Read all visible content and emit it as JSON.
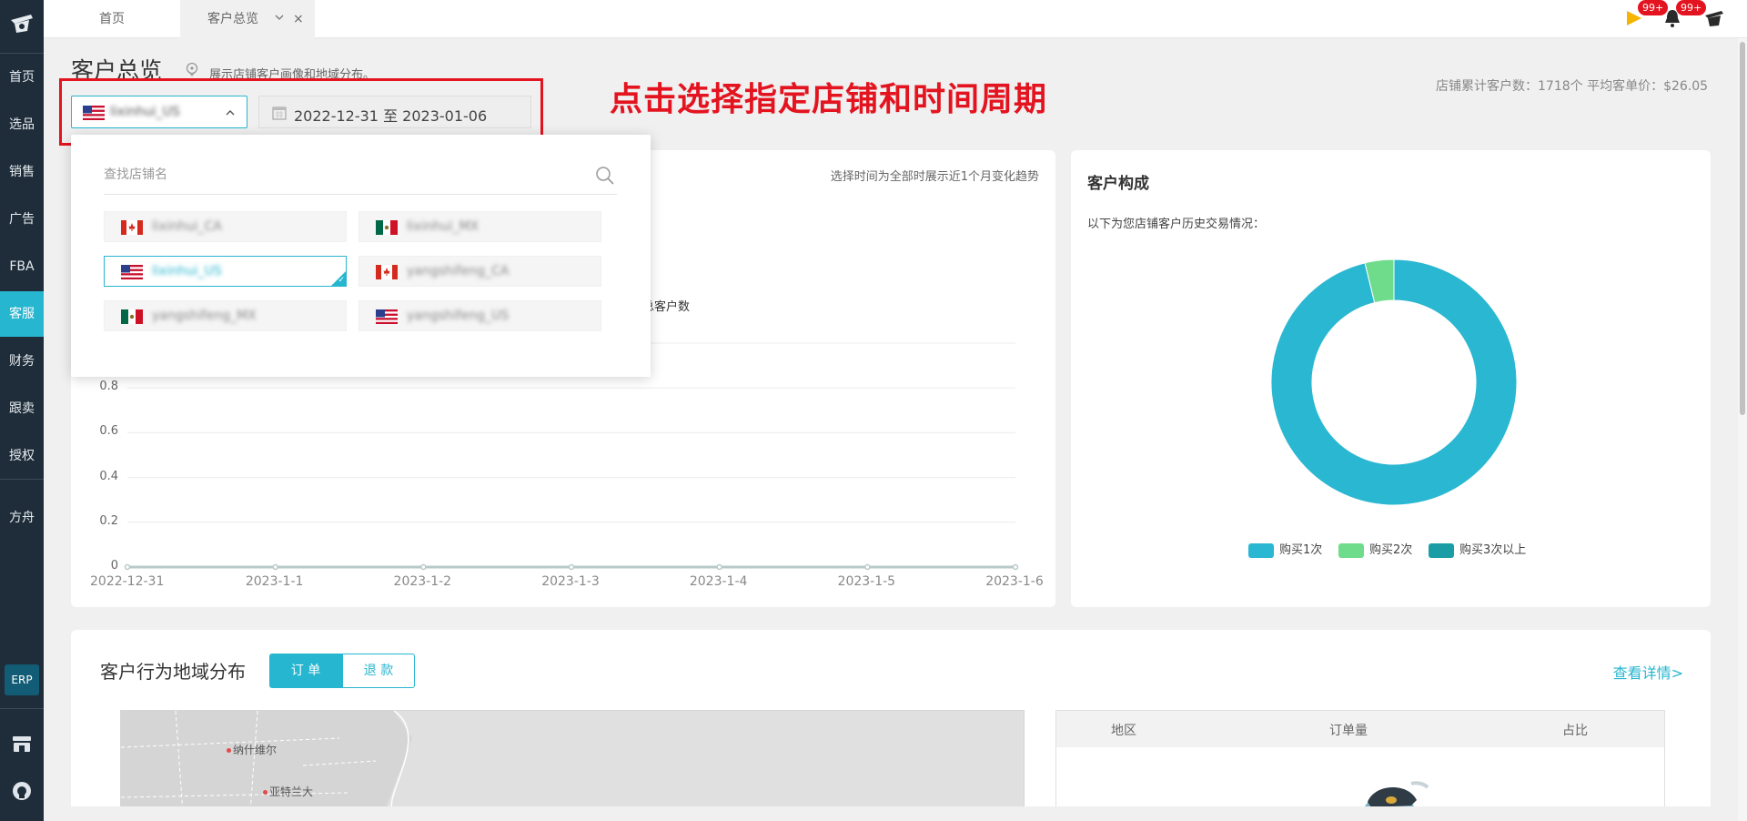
{
  "sidebar": {
    "items": [
      "首页",
      "选品",
      "销售",
      "广告",
      "FBA",
      "客服",
      "财务",
      "跟卖",
      "授权",
      "方舟"
    ],
    "active_index": 5,
    "erp_label": "ERP"
  },
  "tabs": {
    "home": "首页",
    "current": "客户总览",
    "close": "×"
  },
  "notifications": {
    "flag_badge": "99+",
    "bell_badge": "99+"
  },
  "page": {
    "title": "客户总览",
    "description": "展示店铺客户画像和地域分布。",
    "summary": "店铺累计客户数：1718个 平均客单价：$26.05"
  },
  "filters": {
    "shop_value": "lixinhui_US",
    "date_range": "2022-12-31 至 2023-01-06"
  },
  "annotation": "点击选择指定店铺和时间周期",
  "shop_dropdown": {
    "search_placeholder": "查找店铺名",
    "options": [
      {
        "name": "lixinhui_CA",
        "flag": "CA",
        "selected": false
      },
      {
        "name": "lixinhui_MX",
        "flag": "MX",
        "selected": false
      },
      {
        "name": "lixinhui_US",
        "flag": "US",
        "selected": true
      },
      {
        "name": "yangshifeng_CA",
        "flag": "CA",
        "selected": false
      },
      {
        "name": "yangshifeng_MX",
        "flag": "MX",
        "selected": false
      },
      {
        "name": "yangshifeng_US",
        "flag": "US",
        "selected": false
      }
    ]
  },
  "trend": {
    "note": "选择时间为全部时展示近1个月变化趋势",
    "legend_partial": "总客户数"
  },
  "chart_data": [
    {
      "type": "line",
      "x": [
        "2022-12-31",
        "2023-1-1",
        "2023-1-2",
        "2023-1-3",
        "2023-1-4",
        "2023-1-5",
        "2023-1-6"
      ],
      "series": [
        {
          "name": "总客户数",
          "values": [
            0,
            0,
            0,
            0,
            0,
            0,
            0
          ],
          "color": "#b7c9c9"
        }
      ],
      "yticks": [
        "0",
        "0.2",
        "0.4",
        "0.6",
        "0.8"
      ],
      "ylim": [
        0,
        1
      ],
      "grid": true
    },
    {
      "type": "pie",
      "title": "客户构成",
      "subtitle": "以下为您店铺客户历史交易情况：",
      "labels": [
        "购买1次",
        "购买2次",
        "购买3次以上"
      ],
      "values": [
        96.2,
        3.8,
        0
      ],
      "colors": [
        "#2ab7d1",
        "#6fdc8c",
        "#1a9da5"
      ],
      "legend": "bottom"
    }
  ],
  "geo": {
    "title": "客户行为地域分布",
    "segments": [
      "订 单",
      "退 款"
    ],
    "more_link": "查看详情>",
    "cities": [
      "纳什维尔",
      "亚特兰大"
    ],
    "table_headers": [
      "地区",
      "订单量",
      "占比"
    ]
  },
  "colors": {
    "accent": "#26b6cf",
    "sidebar": "#1f2d3a",
    "annotation_red": "#e3141f"
  }
}
